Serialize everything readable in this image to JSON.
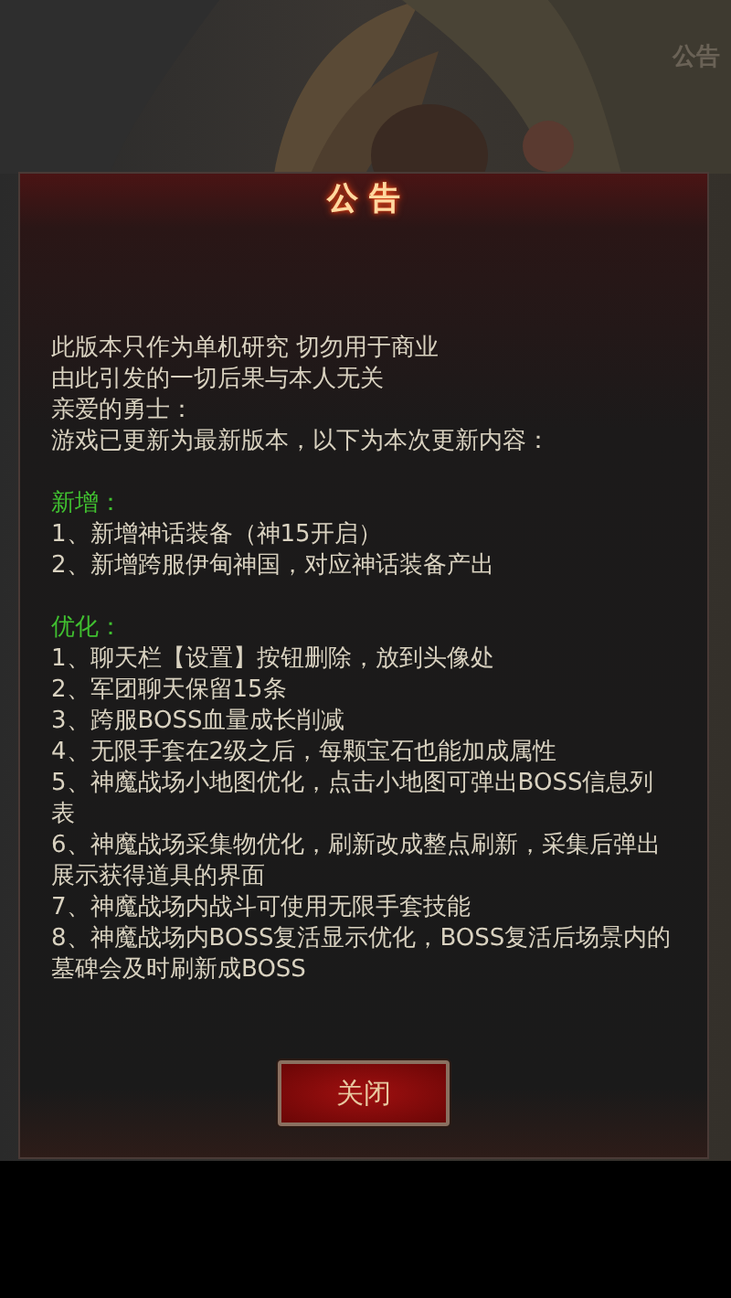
{
  "background": {
    "title": "公告"
  },
  "notice": {
    "title": "公 告",
    "intro": [
      "此版本只作为单机研究 切勿用于商业",
      "由此引发的一切后果与本人无关",
      "亲爱的勇士：",
      "游戏已更新为最新版本，以下为本次更新内容："
    ],
    "sections": [
      {
        "heading": "新增：",
        "items": [
          "1、新增神话装备（神15开启）",
          "2、新增跨服伊甸神国，对应神话装备产出"
        ]
      },
      {
        "heading": "优化：",
        "items": [
          "1、聊天栏【设置】按钮删除，放到头像处",
          "2、军团聊天保留15条",
          "3、跨服BOSS血量成长削减",
          "4、无限手套在2级之后，每颗宝石也能加成属性",
          "5、神魔战场小地图优化，点击小地图可弹出BOSS信息列表",
          "6、神魔战场采集物优化，刷新改成整点刷新，采集后弹出展示获得道具的界面",
          "7、神魔战场内战斗可使用无限手套技能",
          "8、神魔战场内BOSS复活显示优化，BOSS复活后场景内的墓碑会及时刷新成BOSS"
        ]
      }
    ],
    "button": "关闭"
  }
}
